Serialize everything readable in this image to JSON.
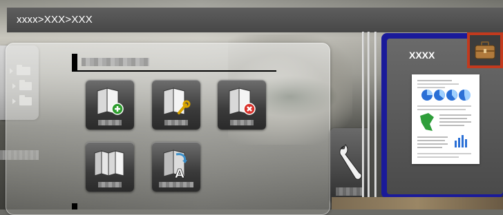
{
  "breadcrumb": "xxxx>XXX>XXX",
  "device": {
    "label": "XXXX"
  },
  "sidebar": {
    "items": [
      "folder-icon",
      "folder-icon",
      "folder-icon"
    ]
  },
  "function_tiles": [
    {
      "icon": "add-box-icon"
    },
    {
      "icon": "edit-box-icon"
    },
    {
      "icon": "delete-box-icon"
    },
    {
      "icon": "copy-box-icon"
    },
    {
      "icon": "rename-box-icon"
    }
  ],
  "tools_icon": "wrench-icon",
  "briefcase_icon": "briefcase-icon",
  "colors": {
    "titlebar": "#4f4f4f",
    "highlight": "#c23a1e",
    "device_frame": "#1a1a9a"
  }
}
